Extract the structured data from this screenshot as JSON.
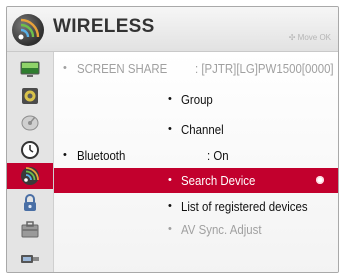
{
  "header": {
    "title": "WIRELESS",
    "hint": "Move  OK"
  },
  "sidebar": {
    "items": [
      {
        "icon": "picture-icon"
      },
      {
        "icon": "audio-icon"
      },
      {
        "icon": "satellite-dish-icon"
      },
      {
        "icon": "clock-icon"
      },
      {
        "icon": "wireless-icon",
        "active": true
      },
      {
        "icon": "lock-icon"
      },
      {
        "icon": "option-icon"
      },
      {
        "icon": "network-icon"
      }
    ]
  },
  "menu": {
    "screen_share": {
      "label": "SCREEN SHARE",
      "value": ": [PJTR][LG]PW1500[0000]"
    },
    "group": {
      "label": "Group"
    },
    "channel": {
      "label": "Channel"
    },
    "bluetooth": {
      "label": "Bluetooth",
      "value": ": On"
    },
    "search_device": {
      "label": "Search Device"
    },
    "registered_devices": {
      "label": "List of registered devices"
    },
    "av_sync": {
      "label": "AV Sync. Adjust"
    }
  },
  "colors": {
    "accent": "#c2002d",
    "text": "#111111",
    "disabled": "#a0a0a0"
  }
}
